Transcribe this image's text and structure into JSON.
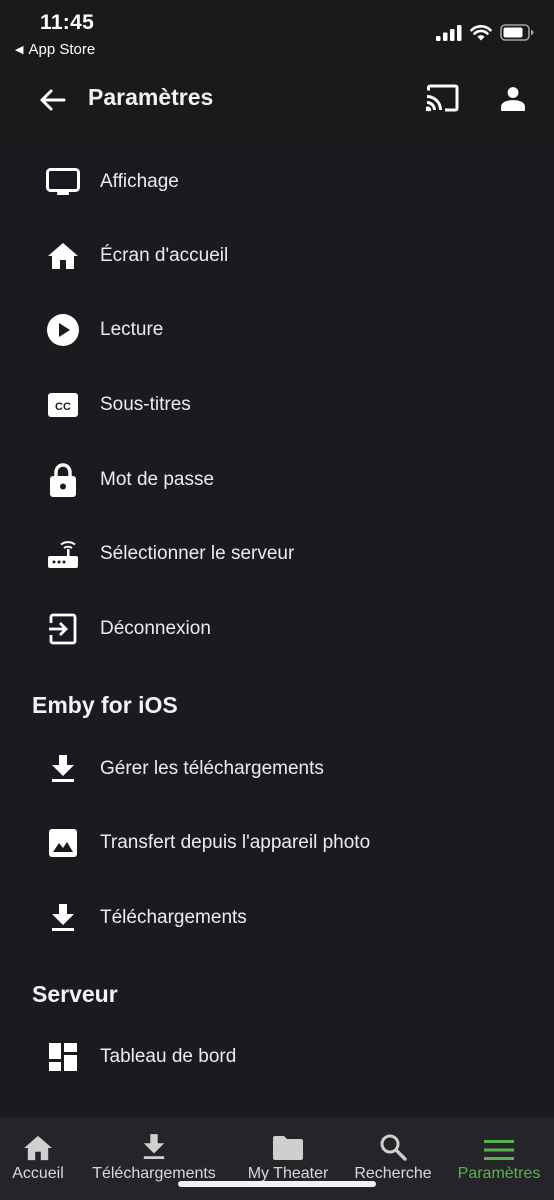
{
  "status_bar": {
    "time": "11:45",
    "back_app": "App Store"
  },
  "app_bar": {
    "title": "Paramètres"
  },
  "rows": [
    {
      "label": "Affichage",
      "icon": "monitor-icon"
    },
    {
      "label": "Écran d'accueil",
      "icon": "home-icon"
    },
    {
      "label": "Lecture",
      "icon": "play-circle-icon"
    },
    {
      "label": "Sous-titres",
      "icon": "closed-caption-icon"
    },
    {
      "label": "Mot de passe",
      "icon": "lock-icon"
    },
    {
      "label": "Sélectionner le serveur",
      "icon": "router-icon"
    },
    {
      "label": "Déconnexion",
      "icon": "exit-icon"
    }
  ],
  "sections": [
    {
      "title": "Emby for iOS",
      "rows": [
        {
          "label": "Gérer les téléchargements",
          "icon": "download-icon"
        },
        {
          "label": "Transfert depuis l'appareil photo",
          "icon": "photo-icon"
        },
        {
          "label": "Téléchargements",
          "icon": "download-icon"
        }
      ]
    },
    {
      "title": "Serveur",
      "rows": [
        {
          "label": "Tableau de bord",
          "icon": "dashboard-icon"
        }
      ]
    }
  ],
  "bottom_nav": [
    {
      "label": "Accueil",
      "icon": "home-icon",
      "active": false
    },
    {
      "label": "Téléchargements",
      "icon": "download-icon",
      "active": false
    },
    {
      "label": "My Theater",
      "icon": "folder-icon",
      "active": false
    },
    {
      "label": "Recherche",
      "icon": "search-icon",
      "active": false
    },
    {
      "label": "Paramètres",
      "icon": "menu-icon",
      "active": true
    }
  ],
  "colors": {
    "background": "#1c1a1f",
    "bar": "#1a1a1a",
    "nav": "#262429",
    "accent": "#52b54b",
    "text": "#ececec"
  }
}
